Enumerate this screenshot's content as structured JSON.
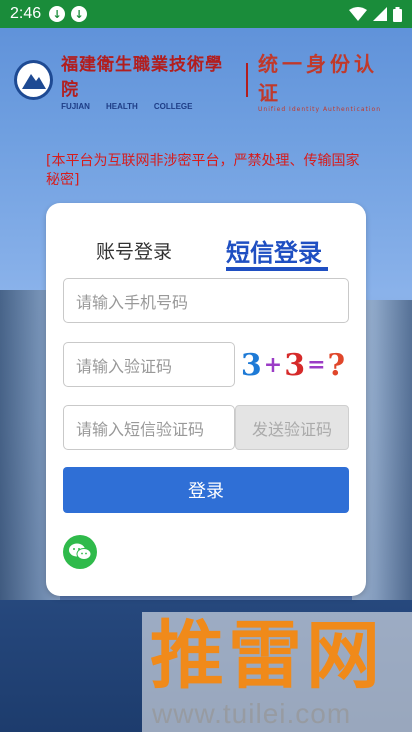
{
  "status_bar": {
    "time": "2:46"
  },
  "header": {
    "school_name": "福建衛生職業技術學院",
    "school_en": [
      "FUJIAN",
      "HEALTH",
      "COLLEGE"
    ],
    "auth_cn": "统一身份认证",
    "auth_en": "Unified Identity Authentication"
  },
  "warning": "[本平台为互联网非涉密平台，严禁处理、传输国家秘密]",
  "tabs": {
    "account": "账号登录",
    "sms": "短信登录"
  },
  "form": {
    "phone_placeholder": "请输入手机号码",
    "captcha_placeholder": "请输入验证码",
    "sms_placeholder": "请输入短信验证码",
    "captcha_text": [
      "3",
      "+",
      "3",
      "=",
      "?"
    ],
    "send_code_label": "发送验证码",
    "login_label": "登录"
  },
  "watermark": {
    "cn": "推雷网",
    "url": "www.tuilei.com"
  },
  "colors": {
    "accent": "#2f6fd6",
    "warning": "#d61d1d",
    "wechat": "#2fba4b",
    "status_bar": "#1a8c3a"
  }
}
